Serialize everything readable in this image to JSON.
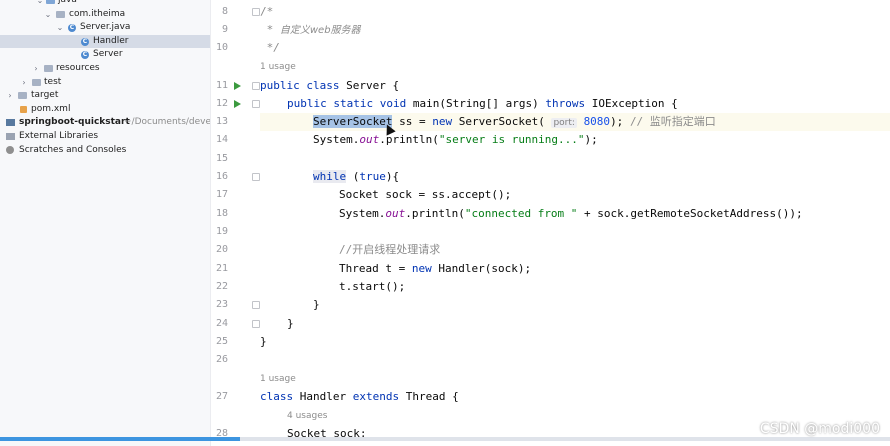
{
  "project_tree": {
    "items": [
      {
        "label": "java"
      },
      {
        "label": "com.itheima"
      },
      {
        "label": "Server.java"
      },
      {
        "label": "Handler"
      },
      {
        "label": "Server"
      },
      {
        "label": "resources"
      },
      {
        "label": "test"
      },
      {
        "label": "target"
      },
      {
        "label": "pom.xml"
      },
      {
        "label": "springboot-quickstart",
        "path": "~/Documents/develo"
      },
      {
        "label": "External Libraries"
      },
      {
        "label": "Scratches and Consoles"
      }
    ]
  },
  "editor": {
    "line_numbers": [
      "8",
      "9",
      "10",
      "11",
      "12",
      "13",
      "14",
      "15",
      "16",
      "17",
      "18",
      "19",
      "20",
      "21",
      "22",
      "23",
      "24",
      "25",
      "26",
      "27",
      "28"
    ],
    "usage_hints": {
      "server_usages": "1 usage",
      "handler_usages": "1 usage",
      "sock_usages": "4 usages"
    },
    "param_hint": "port:",
    "code": {
      "l8": "/*",
      "l9_star": " * ",
      "l9_text": "自定义web服务器",
      "l10": " */",
      "l11_kw1": "public",
      "l11_kw2": "class",
      "l11_rest": " Server {",
      "l12_kw1": "public",
      "l12_kw2": "static",
      "l12_kw3": "void",
      "l12_mid": " main(String[] args) ",
      "l12_kw4": "throws",
      "l12_end": " IOException {",
      "l13_sel": "ServerSocket",
      "l13_a": " ss = ",
      "l13_kw": "new",
      "l13_b": " ServerSocket( ",
      "l13_num": "8080",
      "l13_c": "); ",
      "l13_cmt": "// 监听指定端口",
      "l14_a": "System.",
      "l14_out": "out",
      "l14_b": ".println(",
      "l14_str": "\"server is running...\"",
      "l14_c": ");",
      "l16_kw": "while",
      "l16_a": " (",
      "l16_kw2": "true",
      "l16_b": "){",
      "l17": "Socket sock = ss.accept();",
      "l18_a": "System.",
      "l18_out": "out",
      "l18_b": ".println(",
      "l18_str": "\"connected from \"",
      "l18_c": " + sock.getRemoteSocketAddress());",
      "l20_cmt": "//开启线程处理请求",
      "l21_a": "Thread t = ",
      "l21_kw": "new",
      "l21_b": " Handler(sock);",
      "l22": "t.start();",
      "l23": "}",
      "l24": "}",
      "l25": "}",
      "l27_kw": "class",
      "l27_a": " Handler ",
      "l27_kw2": "extends",
      "l27_b": " Thread {",
      "l28": "Socket sock;"
    }
  },
  "watermark": "CSDN @modi000",
  "colors": {
    "keyword": "#0033b3",
    "string": "#067d17",
    "comment": "#8c8c8c",
    "selection": "#a6c3e6",
    "progress": "#3d95e0"
  }
}
